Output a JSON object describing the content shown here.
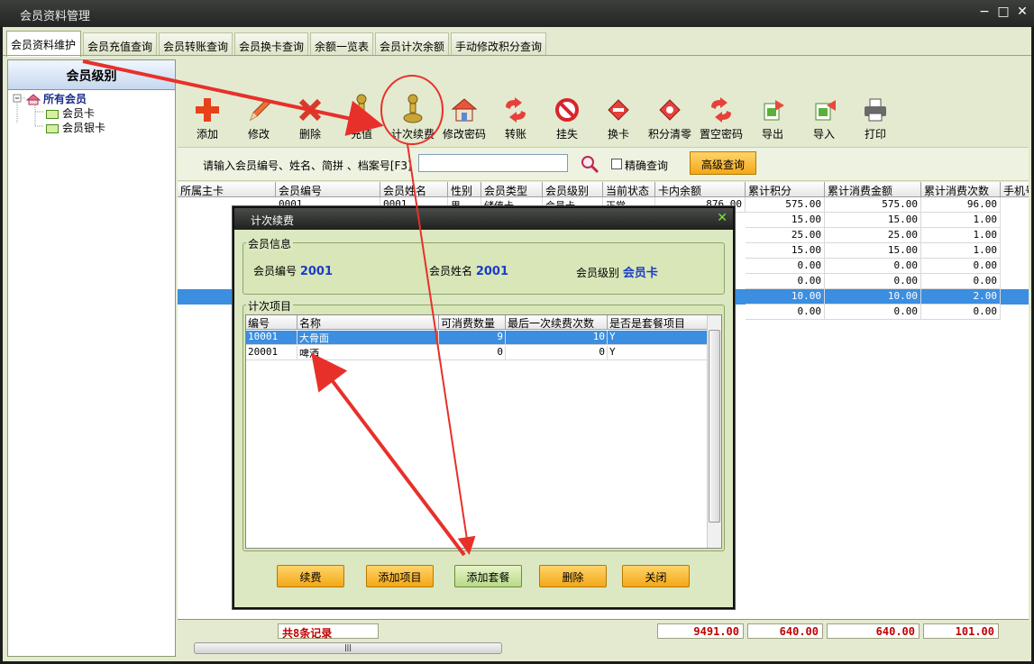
{
  "window": {
    "title": "会员资料管理",
    "controls": [
      "−",
      "□",
      "✕"
    ]
  },
  "tabs": [
    "会员资料维护",
    "会员充值查询",
    "会员转账查询",
    "会员换卡查询",
    "余额一览表",
    "会员计次余额",
    "手动修改积分查询"
  ],
  "sidebar": {
    "header": "会员级别",
    "root": "所有会员",
    "children": [
      "会员卡",
      "会员银卡"
    ]
  },
  "toolbar": [
    "添加",
    "修改",
    "删除",
    "充值",
    "计次续费",
    "修改密码",
    "转账",
    "挂失",
    "换卡",
    "积分清零",
    "置空密码",
    "导出",
    "导入",
    "打印"
  ],
  "search": {
    "label": "请输入会员编号、姓名、简拼 、档案号[F3]",
    "value": "",
    "exact_label": "精确查询",
    "advanced_label": "高级查询"
  },
  "grid": {
    "columns": [
      "所属主卡",
      "会员编号",
      "会员姓名",
      "性别",
      "会员类型",
      "会员级别",
      "当前状态",
      "卡内余额",
      "累计积分",
      "累计消费金额",
      "累计消费次数",
      "手机号"
    ],
    "rows": [
      {
        "points": "575.00",
        "amount": "575.00",
        "count": "96.00"
      },
      {
        "points": "15.00",
        "amount": "15.00",
        "count": "1.00"
      },
      {
        "points": "25.00",
        "amount": "25.00",
        "count": "1.00"
      },
      {
        "points": "15.00",
        "amount": "15.00",
        "count": "1.00"
      },
      {
        "points": "0.00",
        "amount": "0.00",
        "count": "0.00"
      },
      {
        "points": "0.00",
        "amount": "0.00",
        "count": "0.00"
      },
      {
        "points": "10.00",
        "amount": "10.00",
        "count": "2.00"
      },
      {
        "points": "0.00",
        "amount": "0.00",
        "count": "0.00"
      }
    ],
    "first_row_partial": {
      "id": "0001",
      "name": "0001",
      "gender": "男",
      "type": "储值卡",
      "level": "会员卡",
      "status": "正常",
      "balance": "876.00"
    },
    "selected_row": 6
  },
  "footer": {
    "record_count": "共8条记录",
    "total_balance": "9491.00",
    "total_points": "640.00",
    "total_amount": "640.00",
    "total_count": "101.00"
  },
  "dialog": {
    "title": "计次续费",
    "info": {
      "legend": "会员信息",
      "id_label": "会员编号",
      "id": "2001",
      "name_label": "会员姓名",
      "name": "2001",
      "level_label": "会员级别",
      "level": "会员卡"
    },
    "items": {
      "legend": "计次项目",
      "columns": [
        "编号",
        "名称",
        "可消费数量",
        "最后一次续费次数",
        "是否是套餐项目"
      ],
      "rows": [
        {
          "code": "10001",
          "name": "大骨面",
          "qty": "9",
          "last": "10",
          "pkg": "Y"
        },
        {
          "code": "20001",
          "name": "啤酒",
          "qty": "0",
          "last": "0",
          "pkg": "Y"
        }
      ],
      "selected_row": 0
    },
    "buttons": [
      "续费",
      "添加项目",
      "添加套餐",
      "删除",
      "关闭"
    ]
  }
}
